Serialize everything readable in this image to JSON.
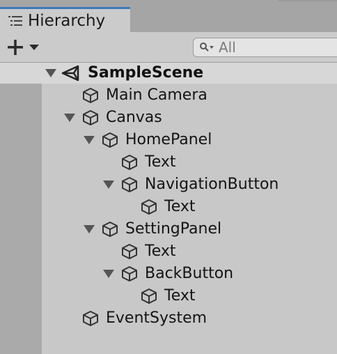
{
  "tab": {
    "title": "Hierarchy",
    "icon": "list-icon"
  },
  "toolbar": {
    "add_icon": "plus-icon",
    "dropdown_icon": "caret-down-icon"
  },
  "search": {
    "placeholder": "All",
    "icon": "search-icon"
  },
  "scene": {
    "name": "SampleScene",
    "icon": "unity-logo-icon",
    "expanded": true
  },
  "items": [
    {
      "label": "Main Camera",
      "depth": 0,
      "expandable": false
    },
    {
      "label": "Canvas",
      "depth": 0,
      "expandable": true
    },
    {
      "label": "HomePanel",
      "depth": 1,
      "expandable": true
    },
    {
      "label": "Text",
      "depth": 2,
      "expandable": false
    },
    {
      "label": "NavigationButton",
      "depth": 2,
      "expandable": true
    },
    {
      "label": "Text",
      "depth": 3,
      "expandable": false
    },
    {
      "label": "SettingPanel",
      "depth": 1,
      "expandable": true
    },
    {
      "label": "Text",
      "depth": 2,
      "expandable": false
    },
    {
      "label": "BackButton",
      "depth": 2,
      "expandable": true
    },
    {
      "label": "Text",
      "depth": 3,
      "expandable": false
    },
    {
      "label": "EventSystem",
      "depth": 0,
      "expandable": false
    }
  ]
}
